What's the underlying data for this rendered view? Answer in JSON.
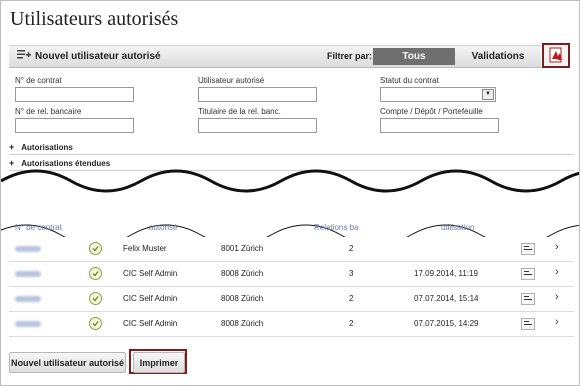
{
  "page": {
    "title": "Utilisateurs autorisés"
  },
  "toolbar": {
    "new_user_label": "Nouvel utilisateur autorisé",
    "filter_label": "Filtrer par:",
    "tabs": [
      {
        "label": "Tous"
      },
      {
        "label": "Validations"
      }
    ]
  },
  "form": {
    "contract_no": {
      "label": "N° de contrat",
      "value": ""
    },
    "authorized_user": {
      "label": "Utilisateur autorisé",
      "value": ""
    },
    "contract_status": {
      "label": "Statut du contrat",
      "value": ""
    },
    "bank_relation_no": {
      "label": "N° de rel. bancaire",
      "value": ""
    },
    "bank_relation_holder": {
      "label": "Titulaire de la rel. banc.",
      "value": ""
    },
    "account": {
      "label": "Compte / Dépôt / Portefeuille",
      "value": ""
    }
  },
  "sections": [
    {
      "label": "Autorisations"
    },
    {
      "label": "Autorisations étendues"
    }
  ],
  "table": {
    "headers": [
      "N° de contrat",
      "autorisé",
      "Relations ba",
      "utilisation"
    ],
    "rows": [
      {
        "name": "Felix Muster",
        "city": "8001 Zürich",
        "relations": "2",
        "last_use": ""
      },
      {
        "name": "CIC Self Admin",
        "city": "8008 Zürich",
        "relations": "3",
        "last_use": "17.09.2014, 11:19"
      },
      {
        "name": "CIC Self Admin",
        "city": "8008 Zürich",
        "relations": "2",
        "last_use": "07.07.2014, 15:14"
      },
      {
        "name": "CIC Self Admin",
        "city": "8008 Zürich",
        "relations": "2",
        "last_use": "07.07.2015, 14:29"
      }
    ]
  },
  "footer": {
    "new_user_label": "Nouvel utilisateur autorisé",
    "print_label": "Imprimer"
  },
  "colors": {
    "accent_dark": "#6f6f6f",
    "highlight_border": "#7a1d1d",
    "header_text": "#6a7fa8",
    "check_green": "#8aa63b"
  },
  "icons": {
    "add_user": "add-user-icon",
    "pdf": "pdf-icon",
    "check": "check-circle-icon",
    "minimize": "minimize-icon",
    "chevron": "chevron-right-icon",
    "expand": "plus-icon"
  }
}
